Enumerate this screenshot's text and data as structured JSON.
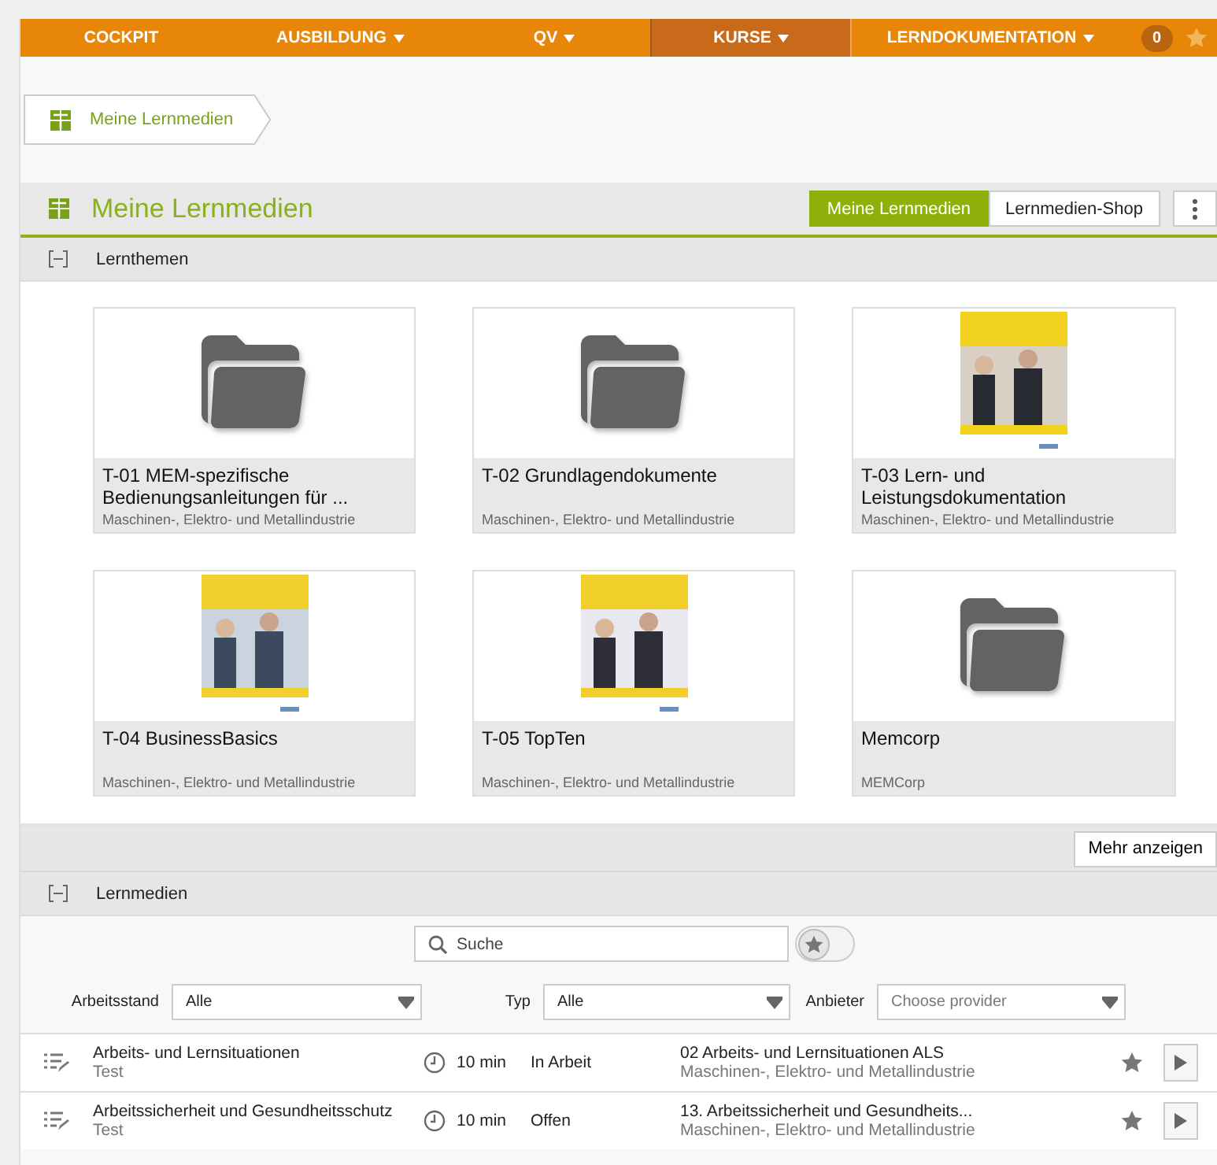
{
  "nav": [
    {
      "label": "COCKPIT",
      "dropdown": false,
      "selected": false
    },
    {
      "label": "AUSBILDUNG",
      "dropdown": true,
      "selected": false
    },
    {
      "label": "QV",
      "dropdown": true,
      "selected": false
    },
    {
      "label": "KURSE",
      "dropdown": true,
      "selected": true
    },
    {
      "label": "LERNDOKUMENTATION",
      "dropdown": true,
      "selected": false
    }
  ],
  "nav_badge": "0",
  "breadcrumb": [
    "Meine Lernmedien"
  ],
  "header": {
    "title": "Meine Lernmedien",
    "view_tabs": [
      {
        "label": "Meine Lernmedien",
        "selected": true
      },
      {
        "label": "Lernmedien-Shop",
        "selected": false
      }
    ]
  },
  "topics": {
    "title": "Lernthemen",
    "expanded": true,
    "cards": [
      {
        "kind": "folder",
        "title": "T-01 MEM-spezifische Bedienungsanleitungen für ...",
        "subtitle": "Maschinen-, Elektro- und Metallindustrie"
      },
      {
        "kind": "folder",
        "title": "T-02 Grundlagendokumente",
        "subtitle": "Maschinen-, Elektro- und Metallindustrie"
      },
      {
        "kind": "picture",
        "title": "T-03 Lern- und Leistungsdokumentation",
        "subtitle": "Maschinen-, Elektro- und Metallindustrie"
      },
      {
        "kind": "picture",
        "title": "T-04 BusinessBasics",
        "subtitle": "Maschinen-, Elektro- und Metallindustrie"
      },
      {
        "kind": "picture",
        "title": "T-05 TopTen",
        "subtitle": "Maschinen-, Elektro- und Metallindustrie"
      },
      {
        "kind": "folder",
        "title": "Memcorp",
        "subtitle": "MEMCorp"
      }
    ],
    "more_button": "Mehr anzeigen"
  },
  "media": {
    "title": "Lernmedien",
    "expanded": true,
    "search": {
      "placeholder": "Suche"
    },
    "favorites_only": {
      "on": false
    },
    "filters": [
      {
        "label": "Arbeitsstand",
        "value": "Alle"
      },
      {
        "label": "Typ",
        "value": "Alle"
      },
      {
        "label": "Anbieter",
        "placeholder": "Choose provider"
      }
    ],
    "rows": [
      {
        "title": "Arbeits- und Lernsituationen",
        "subtitle": "Test",
        "duration": "10 min",
        "status": "In Arbeit",
        "course": "02 Arbeits- und Lernsituationen ALS",
        "provider": "Maschinen-, Elektro- und Metallindustrie"
      },
      {
        "title": "Arbeitssicherheit und Gesundheitsschutz",
        "subtitle": "Test",
        "duration": "10 min",
        "status": "Offen",
        "course": "13. Arbeitssicherheit und Gesundheits...",
        "provider": "Maschinen-, Elektro- und Metallindustrie"
      }
    ]
  }
}
